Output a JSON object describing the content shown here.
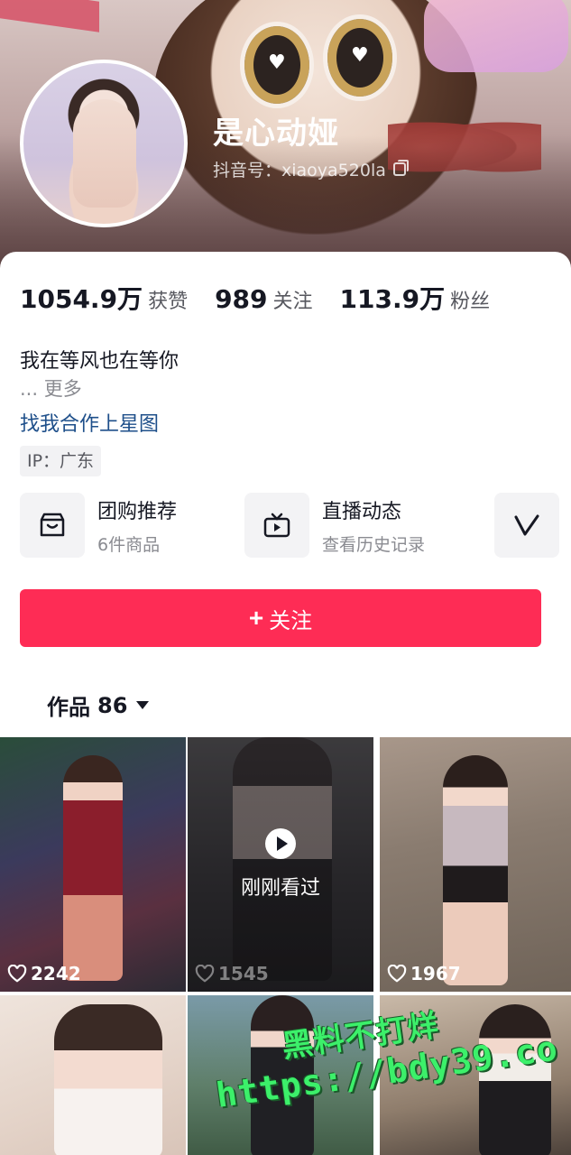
{
  "profile": {
    "nickname": "是心动娅",
    "douyin_id": "抖音号：xiaoya520la",
    "stats": [
      {
        "num": "1054.9万",
        "label": "获赞"
      },
      {
        "num": "989",
        "label": "关注"
      },
      {
        "num": "113.9万",
        "label": "粉丝"
      }
    ],
    "bio": "我在等风也在等你",
    "more": "...  更多",
    "link": "找我合作上星图",
    "ip": "IP：广东"
  },
  "features": [
    {
      "icon": "shop-icon",
      "title": "团购推荐",
      "sub": "6件商品"
    },
    {
      "icon": "tv-icon",
      "title": "直播动态",
      "sub": "查看历史记录"
    },
    {
      "icon": "v-icon",
      "title": "",
      "sub": ""
    }
  ],
  "follow_label": "关注",
  "works": {
    "label": "作品",
    "count": "86"
  },
  "grid": [
    {
      "likes": "2242"
    },
    {
      "likes": "1545",
      "overlay": "刚刚看过"
    },
    {
      "likes": "1967"
    },
    {
      "likes": ""
    },
    {
      "likes": ""
    },
    {
      "likes": ""
    }
  ],
  "watermark": {
    "line1": "黑料不打烊",
    "line2": "https://bdy39.co"
  },
  "colors": {
    "accent": "#fe2c55",
    "link": "#1e4f8a",
    "watermark": "#3cf06a"
  }
}
